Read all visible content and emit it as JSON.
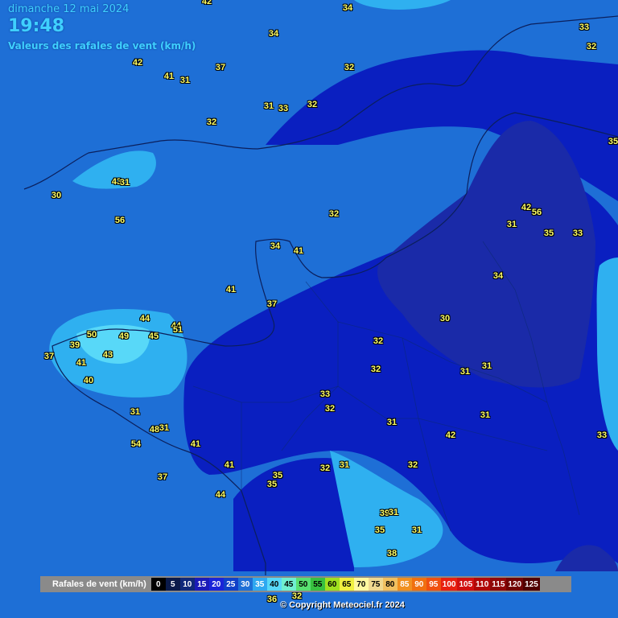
{
  "header": {
    "date": "dimanche 12 mai 2024",
    "time": "19:48",
    "subtitle": "Valeurs des rafales de vent (km/h)"
  },
  "colors": {
    "base": "#1e6fd6",
    "zone_15_20": "#1030d8",
    "zone_20_25": "#0a1fc0",
    "zone_25_30": "#1a2aa8",
    "zone_35_40": "#2fb0f0",
    "zone_40_45": "#58d8f8",
    "coastline": "#0b1f5c"
  },
  "labels": [
    {
      "text": "42"
    },
    {
      "text": "34"
    },
    {
      "text": "34"
    },
    {
      "text": "33"
    },
    {
      "text": "32"
    },
    {
      "text": "42"
    },
    {
      "text": "37"
    },
    {
      "text": "41"
    },
    {
      "text": "31"
    },
    {
      "text": "32"
    },
    {
      "text": "31"
    },
    {
      "text": "33"
    },
    {
      "text": "32"
    },
    {
      "text": "32"
    },
    {
      "text": "35"
    },
    {
      "text": "43"
    },
    {
      "text": "31"
    },
    {
      "text": "30"
    },
    {
      "text": "56"
    },
    {
      "text": "32"
    },
    {
      "text": "42"
    },
    {
      "text": "56"
    },
    {
      "text": "31"
    },
    {
      "text": "35"
    },
    {
      "text": "33"
    },
    {
      "text": "34"
    },
    {
      "text": "41"
    },
    {
      "text": "34"
    },
    {
      "text": "41"
    },
    {
      "text": "37"
    },
    {
      "text": "44"
    },
    {
      "text": "44"
    },
    {
      "text": "51"
    },
    {
      "text": "50"
    },
    {
      "text": "49"
    },
    {
      "text": "45"
    },
    {
      "text": "39"
    },
    {
      "text": "37"
    },
    {
      "text": "43"
    },
    {
      "text": "41"
    },
    {
      "text": "40"
    },
    {
      "text": "30"
    },
    {
      "text": "32"
    },
    {
      "text": "32"
    },
    {
      "text": "31"
    },
    {
      "text": "31"
    },
    {
      "text": "33"
    },
    {
      "text": "32"
    },
    {
      "text": "31"
    },
    {
      "text": "31"
    },
    {
      "text": "42"
    },
    {
      "text": "31"
    },
    {
      "text": "48"
    },
    {
      "text": "31"
    },
    {
      "text": "41"
    },
    {
      "text": "54"
    },
    {
      "text": "37"
    },
    {
      "text": "41"
    },
    {
      "text": "35"
    },
    {
      "text": "35"
    },
    {
      "text": "32"
    },
    {
      "text": "31"
    },
    {
      "text": "32"
    },
    {
      "text": "44"
    },
    {
      "text": "39"
    },
    {
      "text": "31"
    },
    {
      "text": "35"
    },
    {
      "text": "31"
    },
    {
      "text": "38"
    },
    {
      "text": "33"
    },
    {
      "text": "36"
    },
    {
      "text": "32"
    }
  ],
  "legend": {
    "title": "Rafales de vent (km/h)",
    "steps": [
      {
        "value": "0",
        "bg": "#000000",
        "fg": "#ffffff"
      },
      {
        "value": "5",
        "bg": "#0a1a4a",
        "fg": "#ffffff"
      },
      {
        "value": "10",
        "bg": "#10287a",
        "fg": "#ffffff"
      },
      {
        "value": "15",
        "bg": "#1a1ab8",
        "fg": "#ffffff"
      },
      {
        "value": "20",
        "bg": "#1a24d8",
        "fg": "#ffffff"
      },
      {
        "value": "25",
        "bg": "#1040c8",
        "fg": "#ffffff"
      },
      {
        "value": "30",
        "bg": "#1e6fd6",
        "fg": "#ffffff"
      },
      {
        "value": "35",
        "bg": "#2fa8f0",
        "fg": "#ffffff"
      },
      {
        "value": "40",
        "bg": "#58d8f8",
        "fg": "#000000"
      },
      {
        "value": "45",
        "bg": "#70f0d0",
        "fg": "#000000"
      },
      {
        "value": "50",
        "bg": "#58e070",
        "fg": "#000000"
      },
      {
        "value": "55",
        "bg": "#38c040",
        "fg": "#000000"
      },
      {
        "value": "60",
        "bg": "#a0e020",
        "fg": "#000000"
      },
      {
        "value": "65",
        "bg": "#f0f040",
        "fg": "#000000"
      },
      {
        "value": "70",
        "bg": "#fff8a0",
        "fg": "#000000"
      },
      {
        "value": "75",
        "bg": "#f0d890",
        "fg": "#000000"
      },
      {
        "value": "80",
        "bg": "#f0c060",
        "fg": "#000000"
      },
      {
        "value": "85",
        "bg": "#f09020",
        "fg": "#ffffff"
      },
      {
        "value": "90",
        "bg": "#f07010",
        "fg": "#ffffff"
      },
      {
        "value": "95",
        "bg": "#f05010",
        "fg": "#ffffff"
      },
      {
        "value": "100",
        "bg": "#e82010",
        "fg": "#ffffff"
      },
      {
        "value": "105",
        "bg": "#d01010",
        "fg": "#ffffff"
      },
      {
        "value": "110",
        "bg": "#b00808",
        "fg": "#ffffff"
      },
      {
        "value": "115",
        "bg": "#900808",
        "fg": "#ffffff"
      },
      {
        "value": "120",
        "bg": "#700404",
        "fg": "#ffffff"
      },
      {
        "value": "125",
        "bg": "#500000",
        "fg": "#ffffff"
      }
    ]
  },
  "copyright": "© Copyright Meteociel.fr 2024"
}
